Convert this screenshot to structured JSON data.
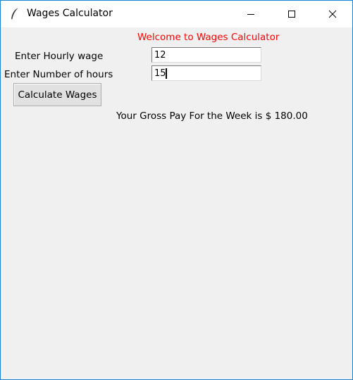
{
  "window": {
    "title": "Wages Calculator",
    "icon": "feather-icon",
    "controls": [
      "minimize-icon",
      "maximize-icon",
      "close-icon"
    ]
  },
  "form": {
    "welcome_text": "Welcome to Wages Calculator",
    "hourly_wage_label": "Enter Hourly wage",
    "hourly_wage_value": "12",
    "hours_label": "Enter Number of hours",
    "hours_value": "15",
    "calculate_button_label": "Calculate Wages",
    "result_text": "Your Gross Pay For the Week is $ 180.00"
  },
  "colors": {
    "welcome_text": "#ff0000",
    "window_background": "#f0f0f0",
    "window_border": "#1883d7"
  }
}
